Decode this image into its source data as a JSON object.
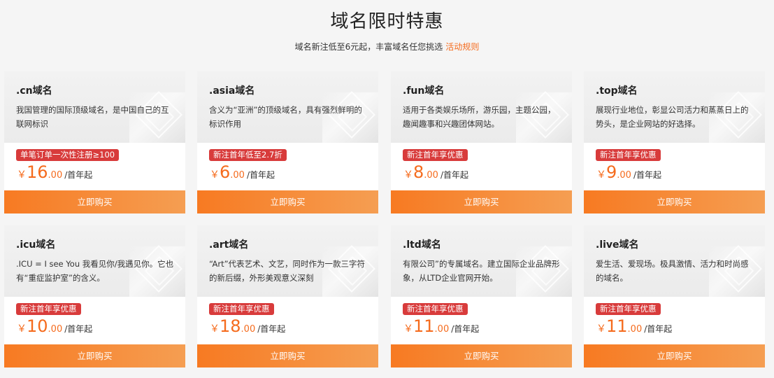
{
  "header": {
    "title": "域名限时特惠",
    "subtitle": "域名新注低至6元起，丰富域名任您挑选",
    "rules_link": "活动规则"
  },
  "colors": {
    "accent": "#f56b1d",
    "badge": "#d83b3b"
  },
  "cards": [
    {
      "name": ".cn域名",
      "desc": "我国管理的国际顶级域名，是中国自己的互联网标识",
      "badge": "单笔订单一次性注册≥100",
      "currency": "￥",
      "price_int": "16",
      "price_dec": ".00",
      "unit": "/首年起",
      "button": "立即购买"
    },
    {
      "name": ".asia域名",
      "desc": "含义为“亚洲”的顶级域名，具有强烈鲜明的标识作用",
      "badge": "新注首年低至2.7折",
      "currency": "￥",
      "price_int": "6",
      "price_dec": ".00",
      "unit": "/首年起",
      "button": "立即购买"
    },
    {
      "name": ".fun域名",
      "desc": "适用于各类娱乐场所，游乐园，主题公园，趣闻趣事和兴趣团体网站。",
      "badge": "新注首年享优惠",
      "currency": "￥",
      "price_int": "8",
      "price_dec": ".00",
      "unit": "/首年起",
      "button": "立即购买"
    },
    {
      "name": ".top域名",
      "desc": "展现行业地位，彰显公司活力和蒸蒸日上的势头，是企业网站的好选择。",
      "badge": "新注首年享优惠",
      "currency": "￥",
      "price_int": "9",
      "price_dec": ".00",
      "unit": "/首年起",
      "button": "立即购买"
    },
    {
      "name": ".icu域名",
      "desc": ".ICU = I see You 我看见你/我遇见你。它也有“重症监护室”的含义。",
      "badge": "新注首年享优惠",
      "currency": "￥",
      "price_int": "10",
      "price_dec": ".00",
      "unit": "/首年起",
      "button": "立即购买"
    },
    {
      "name": ".art域名",
      "desc": "“Art”代表艺术、文艺，同时作为一款三字符的新后缀，外形美观意义深刻",
      "badge": "新注首年享优惠",
      "currency": "￥",
      "price_int": "18",
      "price_dec": ".00",
      "unit": "/首年起",
      "button": "立即购买"
    },
    {
      "name": ".ltd域名",
      "desc": "有限公司”的专属域名。建立国际企业品牌形象，从LTD企业官网开始。",
      "badge": "新注首年享优惠",
      "currency": "￥",
      "price_int": "11",
      "price_dec": ".00",
      "unit": "/首年起",
      "button": "立即购买"
    },
    {
      "name": ".live域名",
      "desc": "爱生活、爱现场。极具激情、活力和时尚感的域名。",
      "badge": "新注首年享优惠",
      "currency": "￥",
      "price_int": "11",
      "price_dec": ".00",
      "unit": "/首年起",
      "button": "立即购买"
    }
  ]
}
